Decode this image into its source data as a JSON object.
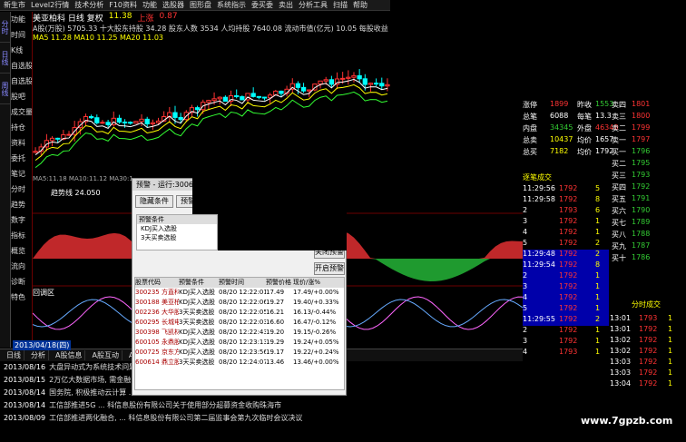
{
  "menubar": {
    "items": [
      "新生市",
      "Level2行情",
      "技术分析",
      "F10资料",
      "功能",
      "选股器",
      "图形盘",
      "系统指示",
      "委买委",
      "卖出",
      "分析工具",
      "扫描",
      "帮助"
    ]
  },
  "left_tabs": [
    "分时",
    "日线",
    "周线"
  ],
  "side_menu": [
    "功能",
    "时间",
    "K线",
    "自选股",
    "自选股",
    "股吧",
    "成交量",
    "持仓",
    "资料",
    "委托",
    "笔记",
    "分时",
    "趋势",
    "数字",
    "指标",
    "概览",
    "流向",
    "诊断",
    "特色"
  ],
  "chart": {
    "stock_title": "美亚柏科 日线 复权",
    "last_price": "11.38",
    "change": "上涨",
    "change_val": "0.87",
    "stats_line1": "A股(万股) 5705.33  十大股东持股 34.28  股东人数 3534  人均持股 7640.08  流动市值(亿元) 10.05  每股收益 0.07  市盈率 29.97",
    "stats_line2": "MA5 11.28  MA10 11.25  MA20 11.03",
    "ma_bar": "MA5:11.18 MA10:11.12  MA30:10.90"
  },
  "indicator": {
    "label1": "趋势线",
    "value1": "24.050",
    "label2": "回调区"
  },
  "bottom_tabs": [
    "日线",
    "分析",
    "A股信息",
    "A股互动",
    "A股财务",
    "热点",
    "投资",
    "资金",
    "财经",
    "主力持仓",
    "其他"
  ],
  "news": [
    {
      "date": "2013/08/16",
      "text": "大盘异动式为系统技术问题 ... 公告:研究报告"
    },
    {
      "date": "2013/08/15",
      "text": "2万亿大数据市场, 需金融...购助力加速开拓侦新市场"
    },
    {
      "date": "2013/08/14",
      "text": "国务院, 积极推动云计算 ... 科信息股份有限公司关于使用自有资金购买银行软件"
    },
    {
      "date": "2013/08/14",
      "text": "工信部推进5G ... 科信息股份有限公司关于使用部分超募资金收购珠海市"
    },
    {
      "date": "2013/08/09",
      "text": "工信部推进两化融合, ... 科信息股份有限公司第二届监事会第九次临时会议决议"
    }
  ],
  "right_panel": {
    "rows": [
      {
        "l": "涨停",
        "v1": "1899",
        "c1": "red",
        "m": "昨收",
        "v2": "1553",
        "c2": "grn"
      },
      {
        "l": "总笔",
        "v1": "6088",
        "c1": "wht",
        "m": "每笔",
        "v2": "13.3",
        "c2": "wht"
      },
      {
        "l": "内盘",
        "v1": "34345",
        "c1": "grn",
        "m": "外盘",
        "v2": "46348",
        "c2": "red"
      },
      {
        "l": "总卖",
        "v1": "10437",
        "c1": "yel",
        "m": "均价",
        "v2": "1657",
        "c2": "wht"
      },
      {
        "l": "总买",
        "v1": "7182",
        "c1": "yel",
        "m": "均价",
        "v2": "1792",
        "c2": "wht"
      }
    ],
    "asks_header": "逐笔成交",
    "ticks": [
      {
        "t": "11:29:56",
        "p": "1792",
        "v": "5"
      },
      {
        "t": "11:29:58",
        "p": "1792",
        "v": "8"
      },
      {
        "t": "2",
        "p": "1793",
        "v": "6"
      },
      {
        "t": "3",
        "p": "1792",
        "v": "1"
      },
      {
        "t": "4",
        "p": "1792",
        "v": "1"
      },
      {
        "t": "5",
        "p": "1792",
        "v": "2"
      },
      {
        "t": "11:29:48",
        "p": "1792",
        "v": "2"
      },
      {
        "t": "11:29:54",
        "p": "1792",
        "v": "8"
      },
      {
        "t": "2",
        "p": "1792",
        "v": "1"
      },
      {
        "t": "3",
        "p": "1792",
        "v": "1"
      },
      {
        "t": "4",
        "p": "1792",
        "v": "1"
      },
      {
        "t": "5",
        "p": "1792",
        "v": "1"
      },
      {
        "t": "11:29:55",
        "p": "1792",
        "v": "2"
      },
      {
        "t": "2",
        "p": "1792",
        "v": "1"
      },
      {
        "t": "3",
        "p": "1792",
        "v": "1"
      },
      {
        "t": "4",
        "p": "1793",
        "v": "1"
      }
    ],
    "side_labels": [
      "卖四",
      "卖三",
      "卖二",
      "卖一",
      "买一",
      "买二",
      "买三",
      "买四",
      "买五",
      "买六",
      "买七",
      "买八",
      "买九",
      "买十"
    ],
    "side_values": [
      "1801",
      "1800",
      "1799",
      "1797",
      "1796",
      "1795",
      "1793",
      "1792",
      "1791",
      "1790",
      "1789",
      "1788",
      "1787",
      "1786"
    ],
    "fen_header": "分时成交",
    "fen_rows": [
      {
        "t": "13:01",
        "p": "1793",
        "v": "1"
      },
      {
        "t": "13:01",
        "p": "1792",
        "v": "1"
      },
      {
        "t": "13:02",
        "p": "1792",
        "v": "1"
      },
      {
        "t": "13:02",
        "p": "1792",
        "v": "1"
      },
      {
        "t": "13:03",
        "p": "1792",
        "v": "1"
      },
      {
        "t": "13:03",
        "p": "1792",
        "v": "1"
      },
      {
        "t": "13:04",
        "p": "1792",
        "v": "1"
      }
    ]
  },
  "dialog": {
    "title": "预警 - 运行:300614 美亚柏科 3天买卖信号",
    "btn_cond": "隐藏条件",
    "btn_analysis": "预警分析",
    "cond_title": "预警条件",
    "conds": [
      "KDJ买入选股",
      "3天买卖选股"
    ],
    "btn_close_warn": "关闭预警",
    "btn_open_warn": "开启预警",
    "table_headers": [
      "股票代码",
      "预警条件",
      "预警时间",
      "预警价格",
      "现价/涨%"
    ],
    "table_rows": [
      [
        "300235 方直科技",
        "KDJ买入选股",
        "08/20 12:22:01",
        "17.49",
        "17.49/+0.00%"
      ],
      [
        "300188 美亚柏科",
        "KDJ买入选股",
        "08/20 12:22:06",
        "19.27",
        "19.40/+0.33%"
      ],
      [
        "002236 大华股份",
        "3天买卖选股",
        "08/20 12:22:05",
        "16.21",
        "16.13/-0.44%"
      ],
      [
        "600295 长城电脑",
        "3天买卖选股",
        "08/20 12:22:03",
        "16.60",
        "16.47/-0.12%"
      ],
      [
        "300398 飞凯材料",
        "KDJ买入选股",
        "08/20 12:22:43",
        "19.20",
        "19.15/-0.26%"
      ],
      [
        "600105 永鼎股份",
        "KDJ买入选股",
        "08/20 12:23:13",
        "19.29",
        "19.24/+0.05%"
      ],
      [
        "000725 京东方A",
        "KDJ买入选股",
        "08/20 12:23:56",
        "19.17",
        "19.22/+0.24%"
      ],
      [
        "600614 鼎立股份",
        "3天买卖选股",
        "08/20 12:24:07",
        "13.46",
        "13.46/+0.00%"
      ]
    ]
  },
  "watermark": "www.7gpzb.com",
  "date_label": "2013/04/18(四)",
  "colors": {
    "up": "#ff3333",
    "down": "#00ffff",
    "ma5": "#ffffff",
    "ma10": "#ffff00",
    "ma20": "#00ff00"
  }
}
